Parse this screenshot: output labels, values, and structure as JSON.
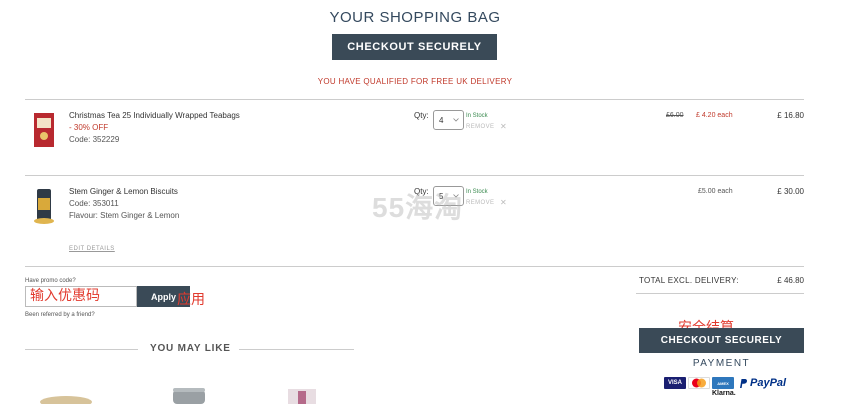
{
  "page": {
    "title": "YOUR SHOPPING BAG",
    "checkout_label": "CHECKOUT SECURELY",
    "delivery_note": "YOU HAVE QUALIFIED FOR FREE UK DELIVERY"
  },
  "items": [
    {
      "name": "Christmas Tea 25 Individually Wrapped Teabags",
      "discount": "- 30% OFF",
      "code": "Code: 352229",
      "qty_label": "Qty:",
      "qty": "4",
      "stock": "In Stock",
      "remove": "REMOVE",
      "old_price": "£6.00",
      "each_price": "£ 4.20 each",
      "line_total": "£ 16.80"
    },
    {
      "name": "Stem Ginger & Lemon Biscuits",
      "code": "Code: 353011",
      "flavour": "Flavour: Stem Ginger & Lemon",
      "qty_label": "Qty:",
      "qty": "5",
      "stock": "In Stock",
      "remove": "REMOVE",
      "each_price": "£5.00 each",
      "line_total": "£ 30.00",
      "edit": "EDIT DETAILS"
    }
  ],
  "promo": {
    "label": "Have promo code?",
    "placeholder": "输入优惠码",
    "apply_label": "Apply",
    "apply_annotation": "应用",
    "referred": "Been referred by a friend?"
  },
  "summary": {
    "total_label": "TOTAL EXCL. DELIVERY:",
    "total_value": "£ 46.80",
    "checkout_annotation": "安全结算",
    "checkout_label": "CHECKOUT SECURELY",
    "payment_label": "PAYMENT",
    "cards": [
      "VISA",
      "AMEX"
    ],
    "paypal": "PayPal",
    "klarna": "Klarna."
  },
  "recommendations": {
    "heading": "YOU MAY LIKE"
  },
  "watermark": "55海淘",
  "colors": {
    "dark_button": "#3a4a57",
    "sale_red": "#c0392b",
    "stock_green": "#3a8a4f",
    "annotation_red": "#e23a2e"
  }
}
